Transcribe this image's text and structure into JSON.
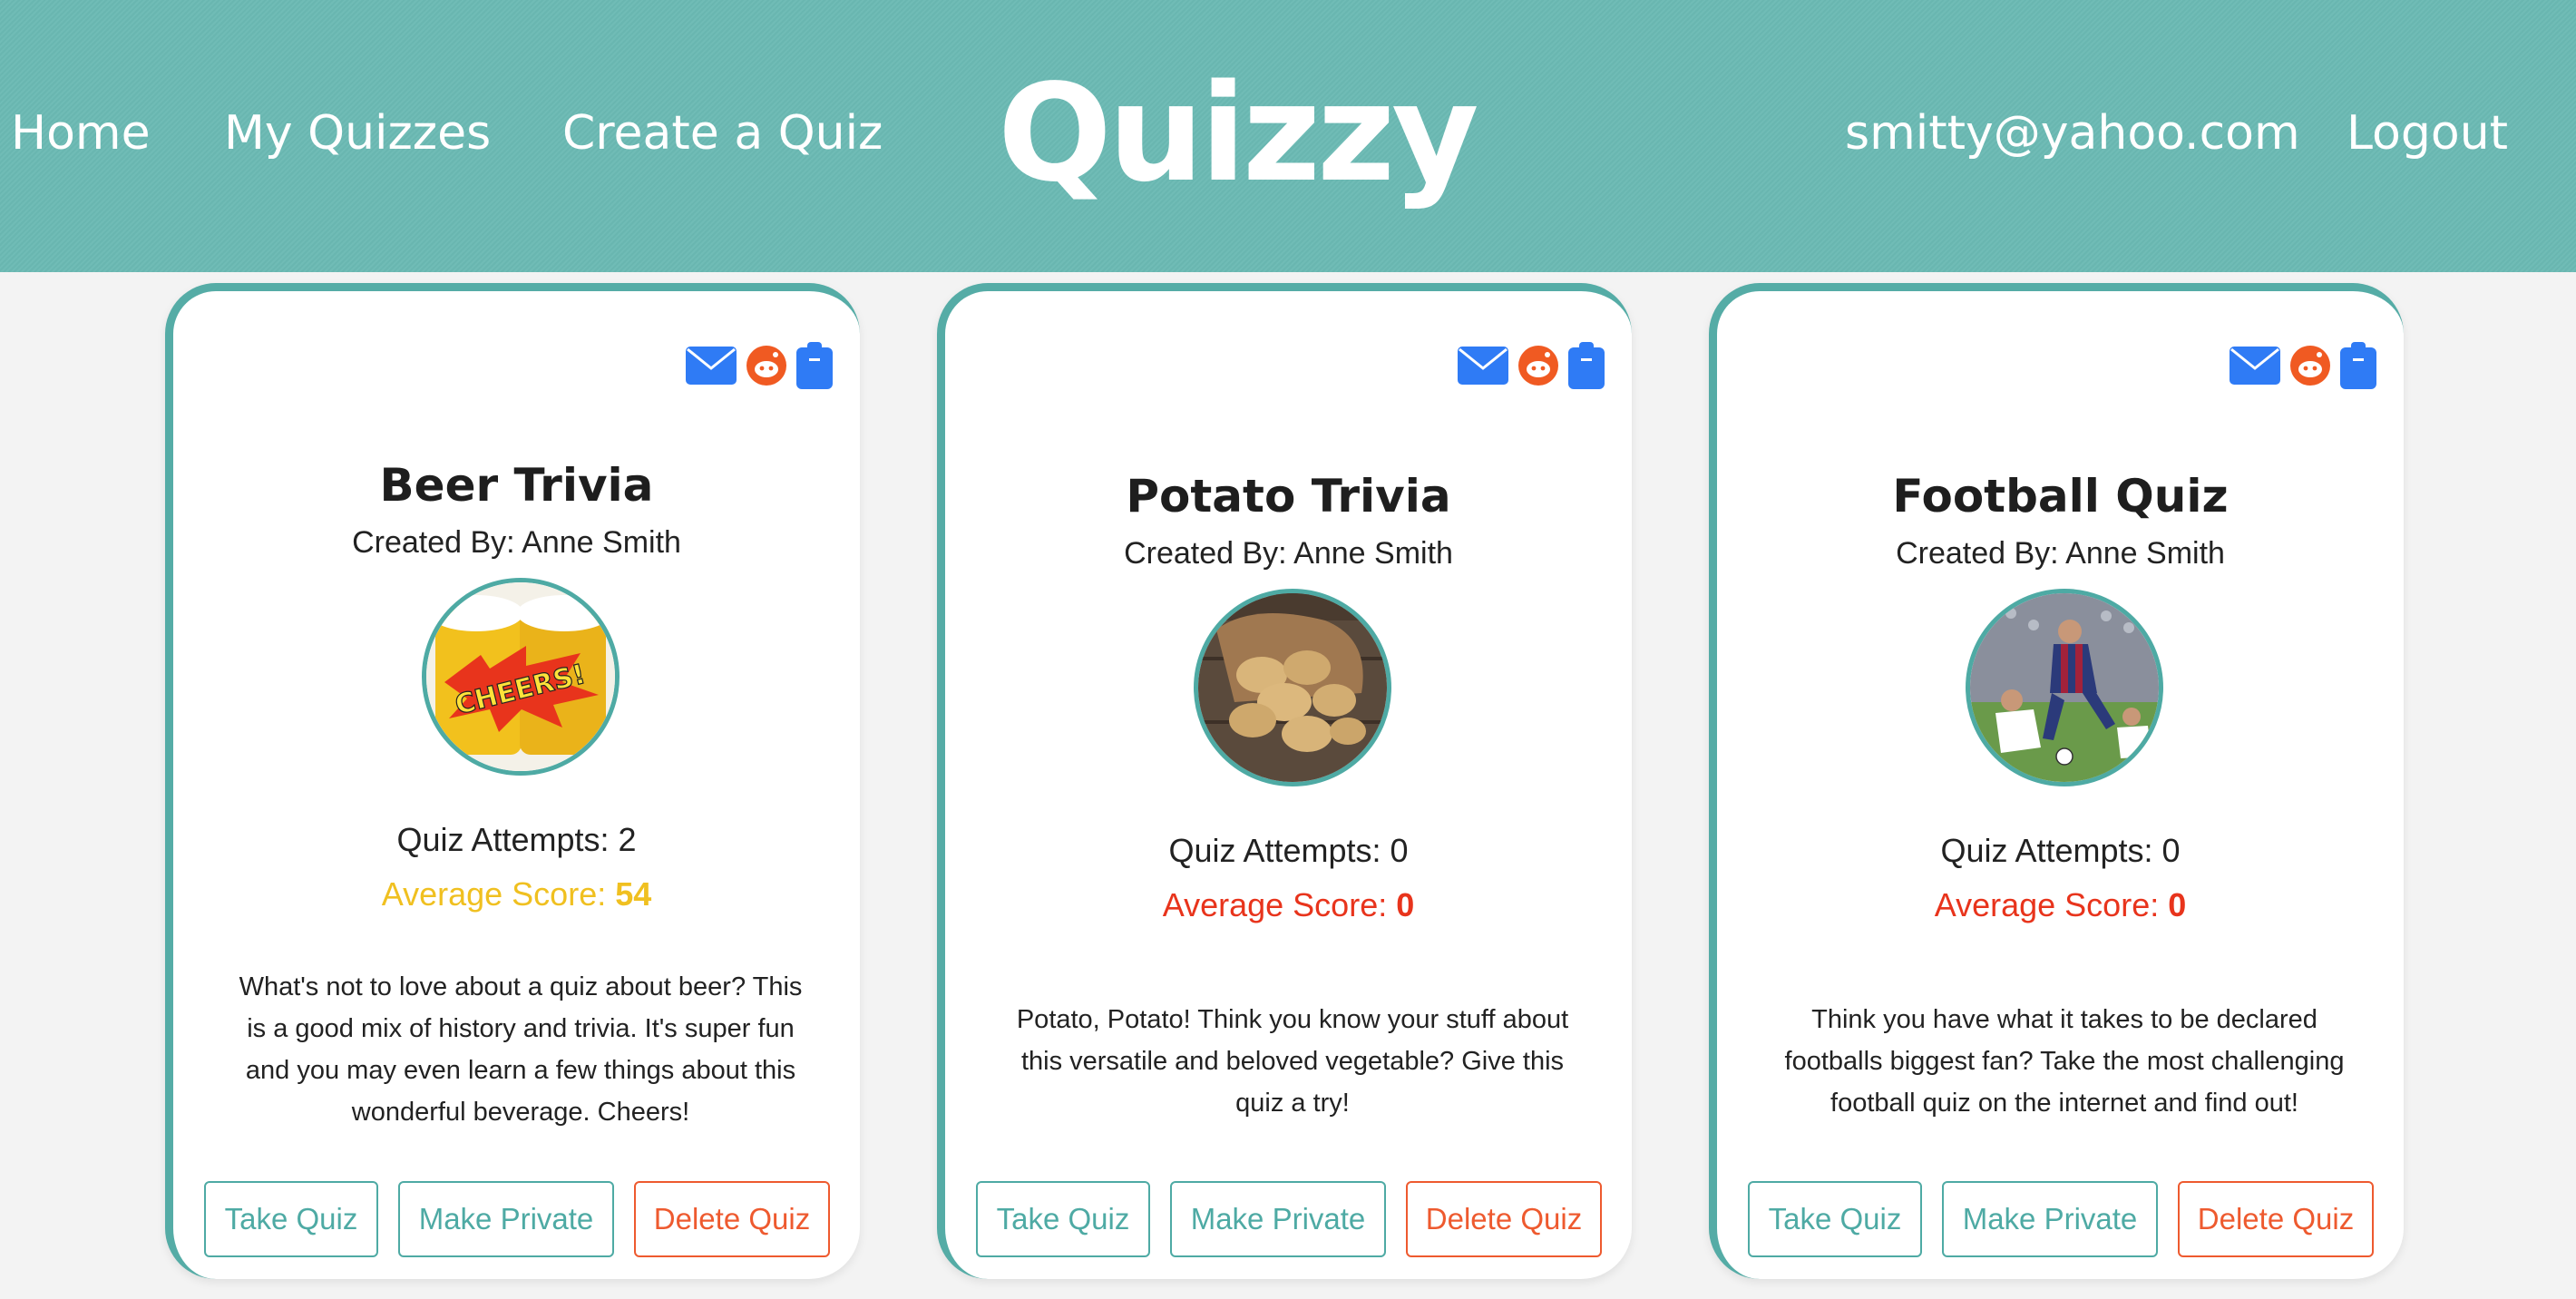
{
  "nav": {
    "home": "Home",
    "my_quizzes": "My Quizzes",
    "create_quiz": "Create a Quiz",
    "brand": "Quizzy",
    "user_email": "smitty@yahoo.com",
    "logout": "Logout"
  },
  "colors": {
    "header_bg": "#6bbab4",
    "teal": "#4eaaa4",
    "score_yellow": "#f0c020",
    "score_red": "#e8341c",
    "delete_orange": "#ee5a2f",
    "icon_blue": "#2f7bf5",
    "reddit_orange": "#f05a22"
  },
  "share_icons": [
    "mail-icon",
    "reddit-icon",
    "clipboard-icon"
  ],
  "labels": {
    "created_by_prefix": "Created By: ",
    "attempts_prefix": "Quiz Attempts: ",
    "avg_prefix": "Average Score: ",
    "take_quiz": "Take Quiz",
    "make_private": "Make Private",
    "delete_quiz": "Delete Quiz"
  },
  "cards": [
    {
      "title": "Beer Trivia",
      "created_by": "Created By: Anne Smith",
      "image": "beer-mugs-cheers-image",
      "image_text": "CHEERS!",
      "attempts": "Quiz Attempts: 2",
      "avg_label": "Average Score: ",
      "avg_value": "54",
      "description": "What's not to love about a quiz about beer? This is a good mix of history and trivia. It's super fun and you may even learn a few things about this wonderful beverage. Cheers!"
    },
    {
      "title": "Potato Trivia",
      "created_by": "Created By: Anne Smith",
      "image": "potatoes-in-sack-image",
      "attempts": "Quiz Attempts: 0",
      "avg_label": "Average Score: ",
      "avg_value": "0",
      "description": "Potato, Potato! Think you know your stuff about this versatile and beloved vegetable? Give this quiz a try!"
    },
    {
      "title": "Football Quiz",
      "created_by": "Created By: Anne Smith",
      "image": "soccer-players-image",
      "attempts": "Quiz Attempts: 0",
      "avg_label": "Average Score: ",
      "avg_value": "0",
      "description": "Think you have what it takes to be declared footballs biggest fan? Take the most challenging football quiz on the internet and find out!"
    }
  ]
}
